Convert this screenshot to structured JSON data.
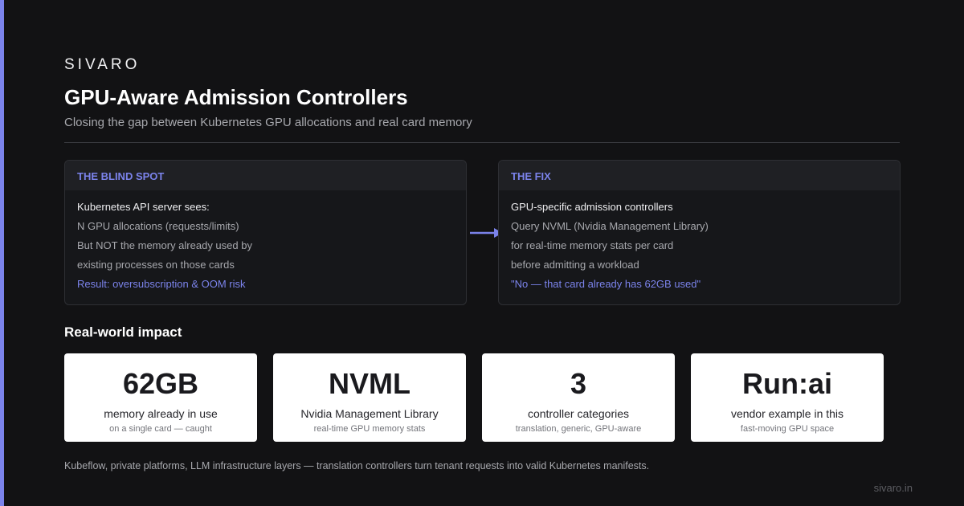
{
  "brand": "SIVARO",
  "title": "GPU-Aware Admission Controllers",
  "subtitle": "Closing the gap between Kubernetes GPU allocations and real card memory",
  "colors": {
    "accent": "#7b83eb",
    "background": "#121214",
    "card": "#ffffff"
  },
  "blind_spot": {
    "heading": "THE BLIND SPOT",
    "lead": "Kubernetes API server sees:",
    "lines": [
      "N GPU allocations (requests/limits)",
      "But NOT the memory already used by",
      "existing processes on those cards"
    ],
    "result": "Result: oversubscription & OOM risk"
  },
  "arrow_icon": "arrow-right-icon",
  "fix": {
    "heading": "THE FIX",
    "lead": "GPU-specific admission controllers",
    "lines": [
      "Query NVML (Nvidia Management Library)",
      "for real-time memory stats per card",
      "before admitting a workload"
    ],
    "result": "\"No — that card already has 62GB used\""
  },
  "impact": {
    "title": "Real-world impact",
    "cards": [
      {
        "value": "62GB",
        "label": "memory already in use",
        "sub": "on a single card — caught"
      },
      {
        "value": "NVML",
        "label": "Nvidia Management Library",
        "sub": "real-time GPU memory stats"
      },
      {
        "value": "3",
        "label": "controller categories",
        "sub": "translation, generic, GPU-aware"
      },
      {
        "value": "Run:ai",
        "label": "vendor example in this",
        "sub": "fast-moving GPU space"
      }
    ]
  },
  "footer": "Kubeflow, private platforms, LLM infrastructure layers — translation controllers turn tenant requests into valid Kubernetes manifests.",
  "site": "sivaro.in"
}
